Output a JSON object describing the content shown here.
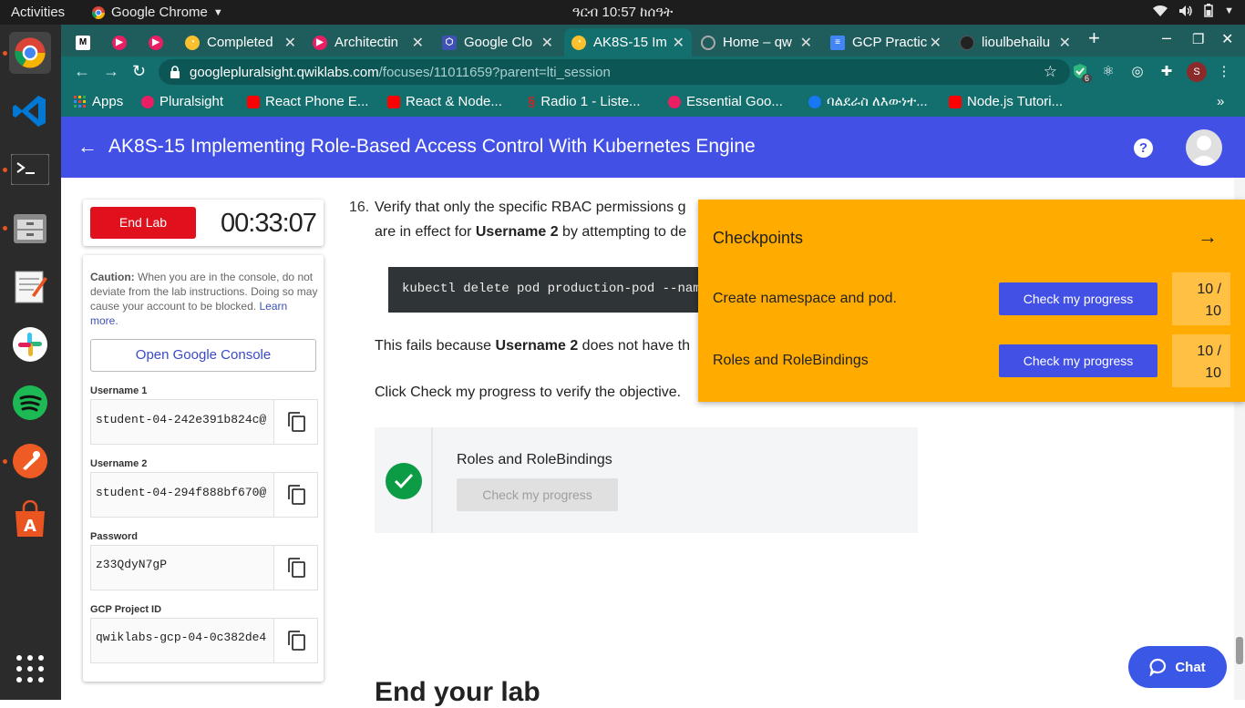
{
  "topbar": {
    "activities": "Activities",
    "app_name": "Google Chrome",
    "clock": "ዓርብ 10:57 ከሰዓት"
  },
  "tabs": [
    {
      "label": "M",
      "color": "#ffffff"
    },
    {
      "label": "",
      "color": "#e91e63"
    },
    {
      "label": "",
      "color": "#e91e63"
    },
    {
      "label": "Completed",
      "color": "#fbc02d"
    },
    {
      "label": "Architectin",
      "color": "#e91e63"
    },
    {
      "label": "Google Clo",
      "color": "#3f51b5"
    },
    {
      "label": "AK8S-15 Im",
      "color": "#fbc02d"
    },
    {
      "label": "Home – qw",
      "color": "#9e9e9e"
    },
    {
      "label": "GCP Practic",
      "color": "#4285f4"
    },
    {
      "label": "lioulbehailu",
      "color": "#222222"
    }
  ],
  "omnibox": {
    "host": "googlepluralsight.qwiklabs.com",
    "path": "/focuses/11011659?parent=lti_session"
  },
  "profile_initial": "S",
  "extension_badge": "6",
  "bookmarks": [
    {
      "label": "Apps",
      "color": "#ea4335"
    },
    {
      "label": "Pluralsight",
      "color": "#e91e63"
    },
    {
      "label": "React Phone E...",
      "color": "#ff0000"
    },
    {
      "label": "React & Node...",
      "color": "#ff0000"
    },
    {
      "label": "Radio 1 - Liste...",
      "color": "#c62828"
    },
    {
      "label": "Essential Goo...",
      "color": "#e91e63"
    },
    {
      "label": "ባልደራስ ለእውነተ...",
      "color": "#1877f2"
    },
    {
      "label": "Node.js Tutori...",
      "color": "#ff0000"
    }
  ],
  "header": {
    "title": "AK8S-15 Implementing Role-Based Access Control With Kubernetes Engine",
    "help": "?"
  },
  "lab": {
    "end_label": "End Lab",
    "timer": "00:33:07",
    "caution_label": "Caution:",
    "caution_text": "When you are in the console, do not deviate from the lab instructions. Doing so may cause your account to be blocked.",
    "learn_more": "Learn more.",
    "console_button": "Open Google Console",
    "credentials": [
      {
        "label": "Username 1",
        "value": "student-04-242e391b824c@"
      },
      {
        "label": "Username 2",
        "value": "student-04-294f888bf670@"
      },
      {
        "label": "Password",
        "value": "z33QdyN7gP"
      },
      {
        "label": "GCP Project ID",
        "value": "qwiklabs-gcp-04-0c382de4"
      }
    ]
  },
  "instructions": {
    "step_number": "16.",
    "line1": "Verify that only the specific RBAC permissions g",
    "line2_pre": "are in effect for ",
    "line2_bold": "Username 2",
    "line2_post": " by attempting to de",
    "code": "kubectl delete pod production-pod --namesp",
    "fail_pre": "This fails because ",
    "fail_bold": "Username 2",
    "fail_post": " does not have th",
    "click_check": "Click Check my progress to verify the objective.",
    "check_title": "Roles and RoleBindings",
    "check_button": "Check my progress",
    "end_heading": "End your lab"
  },
  "checkpoints": {
    "title": "Checkpoints",
    "items": [
      {
        "label": "Create namespace and pod.",
        "button": "Check my progress",
        "score_line1": "10 /",
        "score_line2": "10"
      },
      {
        "label": "Roles and RoleBindings",
        "button": "Check my progress",
        "score_line1": "10 /",
        "score_line2": "10"
      }
    ]
  },
  "chat": {
    "label": "Chat"
  }
}
